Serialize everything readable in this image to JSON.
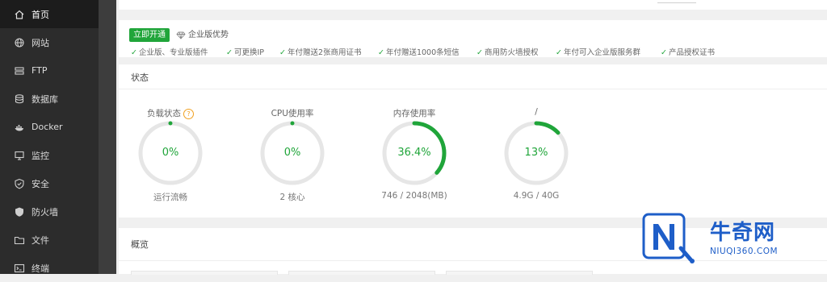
{
  "sidebar": {
    "items": [
      {
        "label": "首页",
        "icon": "home-icon",
        "active": true
      },
      {
        "label": "网站",
        "icon": "globe-icon"
      },
      {
        "label": "FTP",
        "icon": "ftp-icon"
      },
      {
        "label": "数据库",
        "icon": "database-icon"
      },
      {
        "label": "Docker",
        "icon": "docker-icon"
      },
      {
        "label": "监控",
        "icon": "monitor-icon"
      },
      {
        "label": "安全",
        "icon": "shield-outline-icon"
      },
      {
        "label": "防火墙",
        "icon": "firewall-icon"
      },
      {
        "label": "文件",
        "icon": "folder-icon"
      },
      {
        "label": "终端",
        "icon": "terminal-icon"
      }
    ]
  },
  "promo": {
    "open_button": "立即开通",
    "enterprise_advantage": "企业版优势",
    "features": [
      "企业版、专业版插件",
      "可更换IP",
      "年付赠送2张商用证书",
      "年付赠送1000条短信",
      "商用防火墙授权",
      "年付可入企业版服务群",
      "产品授权证书"
    ]
  },
  "status": {
    "title": "状态",
    "gauges": [
      {
        "label": "负载状态",
        "value": "0%",
        "percent": 0,
        "sub": "运行流畅",
        "has_help": true
      },
      {
        "label": "CPU使用率",
        "value": "0%",
        "percent": 0,
        "sub": "2 核心",
        "has_help": false
      },
      {
        "label": "内存使用率",
        "value": "36.4%",
        "percent": 36.4,
        "sub": "746 / 2048(MB)",
        "has_help": false
      },
      {
        "label": "/",
        "value": "13%",
        "percent": 13,
        "sub": "4.9G / 40G",
        "has_help": false
      }
    ]
  },
  "overview": {
    "title": "概览"
  },
  "watermark": {
    "brand": "牛奇网",
    "domain": "NIUQI360.COM"
  },
  "colors": {
    "accent": "#20a53a",
    "sidebar_bg": "#2c2c2c",
    "track": "#e6e6e6",
    "brand": "#1e5ec8"
  }
}
